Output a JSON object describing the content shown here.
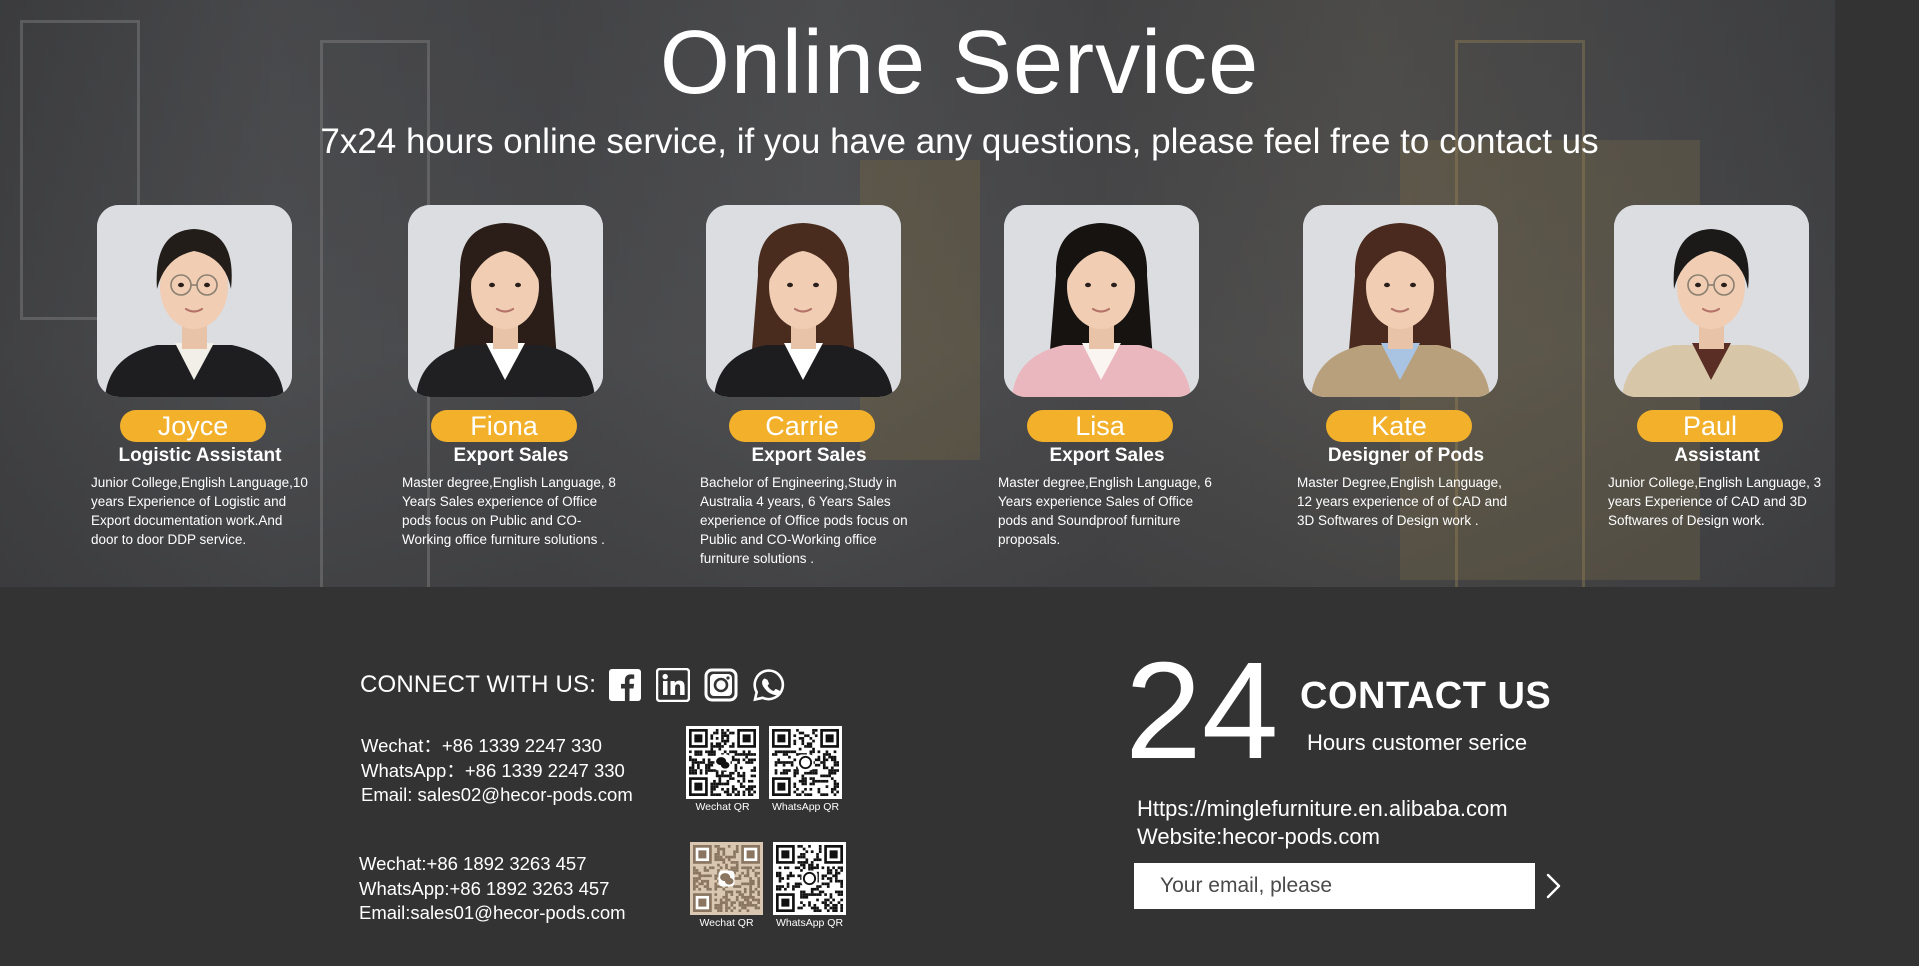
{
  "banner": {
    "title": "Online Service",
    "subtitle": "7x24 hours online service, if you have any questions, please feel free to contact us"
  },
  "team": [
    {
      "name": "Joyce",
      "role": "Logistic Assistant",
      "desc": "Junior College,English Language,10 years Experience of Logistic and Export documentation work.And door to door DDP service.",
      "hair": "#231d19",
      "jacket": "#1e1e20",
      "shirt": "#f2efe8",
      "glasses": true
    },
    {
      "name": "Fiona",
      "role": "Export Sales",
      "desc": "Master degree,English Language, 8 Years Sales experience of Office pods focus on Public and CO-Working office furniture solutions .",
      "hair": "#2b1e18",
      "jacket": "#202022",
      "shirt": "#ffffff",
      "glasses": false
    },
    {
      "name": "Carrie",
      "role": "Export Sales",
      "desc": "Bachelor of Engineering,Study in Australia 4 years, 6 Years Sales experience of Office pods focus on Public and CO-Working office furniture solutions .",
      "hair": "#4a2c1f",
      "jacket": "#1d1d1f",
      "shirt": "#ffffff",
      "glasses": false
    },
    {
      "name": "Lisa",
      "role": "Export Sales",
      "desc": "Master degree,English Language, 6 Years experience Sales of Office pods and Soundproof furniture proposals.",
      "hair": "#161311",
      "jacket": "#e9b7bd",
      "shirt": "#fbf5f2",
      "glasses": false
    },
    {
      "name": "Kate",
      "role": "Designer of Pods",
      "desc": "Master Degree,English Language, 12 years experience of of CAD and 3D Softwares of Design work .",
      "hair": "#4a2a1e",
      "jacket": "#b9a07c",
      "shirt": "#a9c3e2",
      "glasses": false
    },
    {
      "name": "Paul",
      "role": "Assistant",
      "desc": "Junior College,English Language, 3 years Experience of CAD and 3D Softwares of Design work.",
      "hair": "#1b1a19",
      "jacket": "#d8c6a8",
      "shirt": "#5a2d25",
      "glasses": true
    }
  ],
  "connect": {
    "label": "CONNECT WITH US:",
    "icons": [
      "facebook-icon",
      "linkedin-icon",
      "instagram-icon",
      "whatsapp-icon"
    ]
  },
  "contact1": {
    "wechat": "Wechat：+86 1339 2247 330",
    "whatsapp": "WhatsApp：+86 1339 2247 330",
    "email": "Email: sales02@hecor-pods.com",
    "qr_wechat": "Wechat QR",
    "qr_whatsapp": "WhatsApp QR"
  },
  "contact2": {
    "wechat": "Wechat:+86 1892 3263 457",
    "whatsapp": "WhatsApp:+86 1892 3263 457",
    "email": "Email:sales01@hecor-pods.com",
    "qr_wechat": "Wechat QR",
    "qr_whatsapp": "WhatsApp QR"
  },
  "contact_us": {
    "big_number": "24",
    "title": "CONTACT US",
    "subtitle": "Hours customer serice",
    "alibaba": "Https://minglefurniture.en.alibaba.com",
    "website": "Website:hecor-pods.com",
    "email_placeholder": "Your email, please"
  },
  "colors": {
    "accent": "#f2b02b",
    "footer_bg": "#333333",
    "photo_bg": "#dcdde0"
  }
}
